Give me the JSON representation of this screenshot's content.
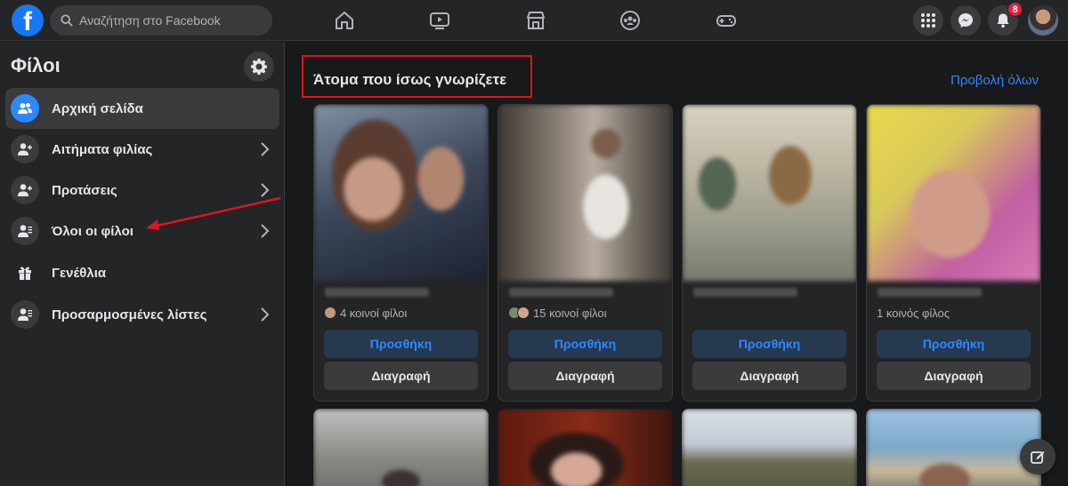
{
  "topbar": {
    "logo_letter": "f",
    "search_placeholder": "Αναζήτηση στο Facebook",
    "nav_icons": [
      "home-icon",
      "watch-icon",
      "marketplace-icon",
      "groups-icon",
      "gaming-icon"
    ],
    "right_icons": [
      "menu-grid-icon",
      "messenger-icon",
      "notifications-icon"
    ],
    "notification_count": "8",
    "colors": {
      "brand": "#1877f2",
      "badge": "#e41e3f"
    }
  },
  "sidebar": {
    "title": "Φίλοι",
    "items": [
      {
        "label": "Αρχική σελίδα",
        "icon": "friends-home-icon",
        "active": true,
        "chevron": false
      },
      {
        "label": "Αιτήματα φιλίας",
        "icon": "friend-requests-icon",
        "active": false,
        "chevron": true
      },
      {
        "label": "Προτάσεις",
        "icon": "suggestions-icon",
        "active": false,
        "chevron": true
      },
      {
        "label": "Όλοι οι φίλοι",
        "icon": "all-friends-icon",
        "active": false,
        "chevron": true
      },
      {
        "label": "Γενέθλια",
        "icon": "gift-icon",
        "active": false,
        "chevron": false
      },
      {
        "label": "Προσαρμοσμένες λίστες",
        "icon": "custom-lists-icon",
        "active": false,
        "chevron": true
      }
    ]
  },
  "main": {
    "section_title": "Άτομα που ίσως γνωρίζετε",
    "see_all": "Προβολή όλων",
    "cards": [
      {
        "mutual": "4 κοινοί φίλοι",
        "add": "Προσθήκη",
        "remove": "Διαγραφή"
      },
      {
        "mutual": "15 κοινοί φίλοι",
        "add": "Προσθήκη",
        "remove": "Διαγραφή"
      },
      {
        "mutual": "",
        "add": "Προσθήκη",
        "remove": "Διαγραφή"
      },
      {
        "mutual": "1 κοινός φίλος",
        "add": "Προσθήκη",
        "remove": "Διαγραφή"
      }
    ],
    "colors": {
      "link": "#2d88ff",
      "highlight_box": "#e0141e"
    }
  }
}
